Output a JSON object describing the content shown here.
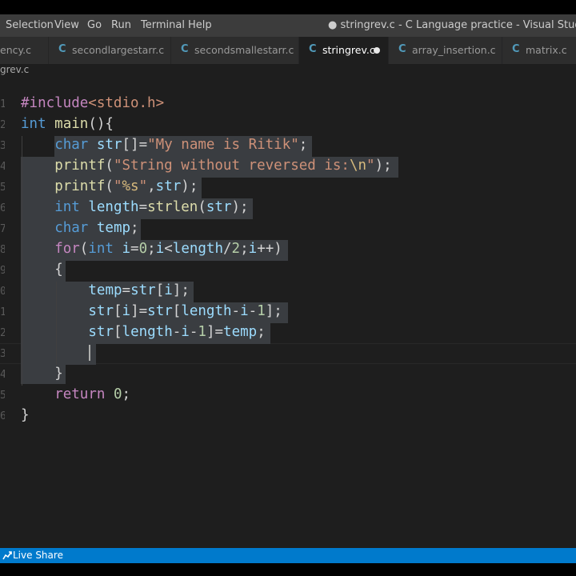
{
  "menu": [
    "Selection",
    "View",
    "Go",
    "Run",
    "Terminal",
    "Help"
  ],
  "window_title": "● stringrev.c - C Language practice - Visual Studio Code",
  "tabs": [
    {
      "label": "ency.c",
      "active": false,
      "dirty": false
    },
    {
      "label": "secondlargestarr.c",
      "active": false,
      "dirty": false
    },
    {
      "label": "secondsmallestarr.c",
      "active": false,
      "dirty": false
    },
    {
      "label": "stringrev.c",
      "active": true,
      "dirty": true
    },
    {
      "label": "array_insertion.c",
      "active": false,
      "dirty": false
    },
    {
      "label": "matrix.c",
      "active": false,
      "dirty": false
    }
  ],
  "tab_icon": "C",
  "breadcrumb": "grev.c",
  "code_lines": [
    "#include<stdio.h>",
    "int main(){",
    "    char str[]=\"My name is Ritik\";",
    "    printf(\"String without reversed is:\\n\");",
    "    printf(\"%s\",str);",
    "    int length=strlen(str);",
    "    char temp;",
    "    for(int i=0;i<length/2;i++)",
    "    {",
    "        temp=str[i];",
    "        str[i]=str[length-i-1];",
    "        str[length-i-1]=temp;",
    "        ",
    "    }",
    "    return 0;",
    "}"
  ],
  "statusbar": {
    "live_share": "Live Share"
  },
  "colors": {
    "keyword": "#569cd6",
    "control": "#c586c0",
    "function": "#dcdcaa",
    "variable": "#9cdcfe",
    "string": "#ce9178",
    "number": "#b5cea8",
    "selection": "#3a3d41",
    "statusbar": "#007acc"
  }
}
